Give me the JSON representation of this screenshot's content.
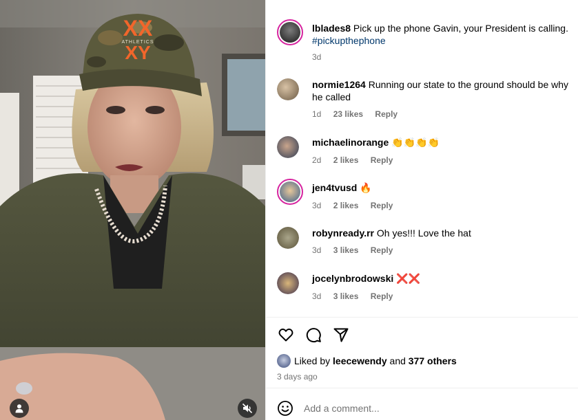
{
  "post_caption": {
    "username": "lblades8",
    "text": "Pick up the phone Gavin, your President is calling.",
    "hashtag": "#pickupthephone",
    "time": "3d"
  },
  "comments": [
    {
      "username": "normie1264",
      "text": "Running our state to the ground should be why he called",
      "time": "1d",
      "likes": "23 likes",
      "reply": "Reply"
    },
    {
      "username": "michaelinorange",
      "text": "👏👏👏👏",
      "time": "2d",
      "likes": "2 likes",
      "reply": "Reply"
    },
    {
      "username": "jen4tvusd",
      "text": "🔥",
      "time": "3d",
      "likes": "2 likes",
      "reply": "Reply"
    },
    {
      "username": "robynready.rr",
      "text": "Oh yes!!! Love the hat",
      "time": "3d",
      "likes": "3 likes",
      "reply": "Reply"
    },
    {
      "username": "jocelynbrodowski",
      "text": "❌❌",
      "time": "3d",
      "likes": "3 likes",
      "reply": "Reply"
    }
  ],
  "likes": {
    "prefix": "Liked by",
    "user": "leecewendy",
    "joiner": "and",
    "others": "377 others"
  },
  "posted_ago": "3 days ago",
  "add_comment": {
    "placeholder": "Add a comment..."
  },
  "hat_text": {
    "top": "XX",
    "middle": "ATHLETICS",
    "bottom": "XY"
  },
  "icons": {
    "like": "heart-icon",
    "comment": "comment-bubble-icon",
    "share": "paper-plane-icon",
    "emoji": "smiley-icon",
    "user_tag": "user-icon",
    "mute": "speaker-muted-icon"
  },
  "colors": {
    "link": "#00376b",
    "meta": "#737373",
    "story_ring": "#d6249f",
    "hat_logo": "#f2662b"
  }
}
